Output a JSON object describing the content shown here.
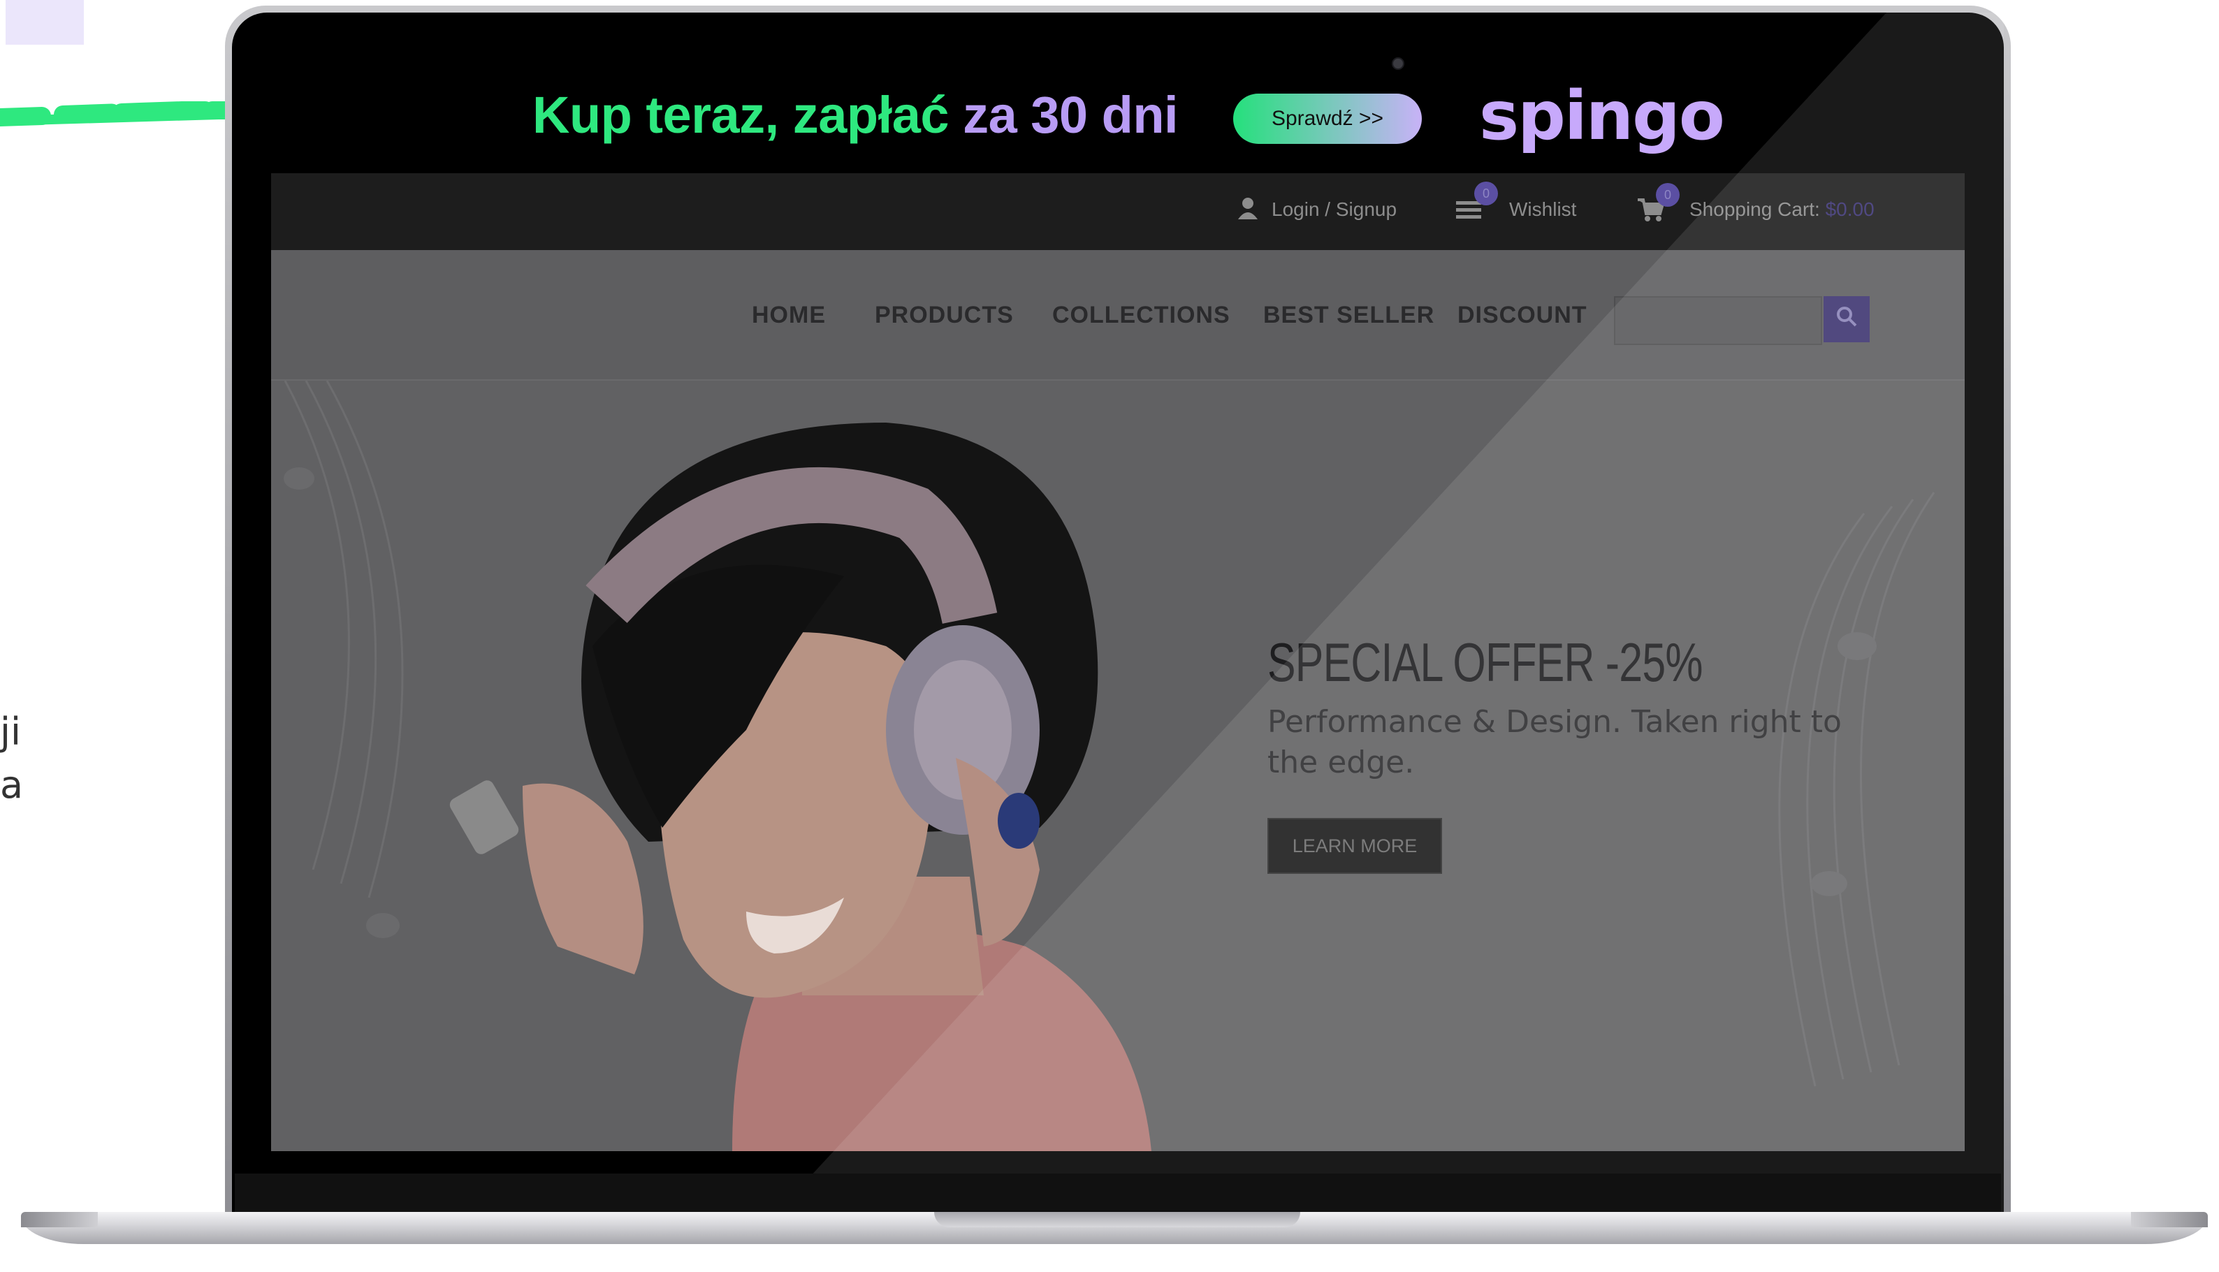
{
  "side_text": {
    "line1": "ji",
    "line2": "a"
  },
  "banner": {
    "text_green": "Kup teraz, zapłać ",
    "text_purple": "za 30 dni",
    "button_label": "Sprawdź  >>",
    "brand": "spingo"
  },
  "site": {
    "topbar": {
      "login_label": "Login / Signup",
      "wishlist_label": "Wishlist",
      "wishlist_count": "0",
      "cart_label": "Shopping Cart:",
      "cart_total": "$0.00",
      "cart_count": "0"
    },
    "nav": {
      "items": [
        "HOME",
        "PRODUCTS",
        "COLLECTIONS",
        "BEST SELLER",
        "DISCOUNT"
      ],
      "search_placeholder": ""
    },
    "hero": {
      "title": "SPECIAL OFFER -25%",
      "subtitle": "Performance & Design. Taken right to the edge.",
      "button_label": "LEARN MORE"
    }
  },
  "icons": [
    "user-icon",
    "list-icon",
    "cart-icon",
    "search-icon",
    "arrow-icon",
    "camera-icon"
  ],
  "colors": {
    "banner_green": "#2ee87f",
    "banner_purple": "#b89cf5",
    "site_accent": "#3e3571"
  }
}
